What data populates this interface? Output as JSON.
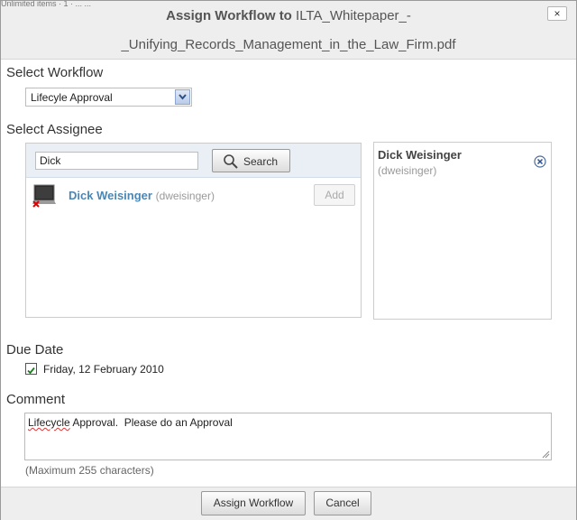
{
  "dialog": {
    "background_text": "Unlimited items · 1 · ...   ...",
    "title_prefix": "Assign Workflow to",
    "title_file_part1": "ILTA_Whitepaper_-",
    "title_file_part2": "_Unifying_Records_Management_in_the_Law_Firm.pdf",
    "close_label": "×"
  },
  "workflow": {
    "section_label": "Select Workflow",
    "selected": "Lifecyle Approval"
  },
  "assignee": {
    "section_label": "Select Assignee",
    "search_value": "Dick",
    "search_button": "Search",
    "results": [
      {
        "name": "Dick Weisinger",
        "id": "(dweisinger)",
        "add_label": "Add"
      }
    ],
    "selected": [
      {
        "name": "Dick Weisinger",
        "id": "(dweisinger)"
      }
    ]
  },
  "due_date": {
    "section_label": "Due Date",
    "checked": true,
    "value": "Friday, 12 February 2010"
  },
  "comment": {
    "section_label": "Comment",
    "value_misspelled": "Lifecycle",
    "value_rest": " Approval.  Please do an Approval",
    "hint": "(Maximum 255 characters)"
  },
  "footer": {
    "assign_label": "Assign Workflow",
    "cancel_label": "Cancel"
  },
  "colors": {
    "accent_link": "#4b86b4",
    "focus_border": "#e0b860",
    "header_bg": "#eeeeee"
  }
}
